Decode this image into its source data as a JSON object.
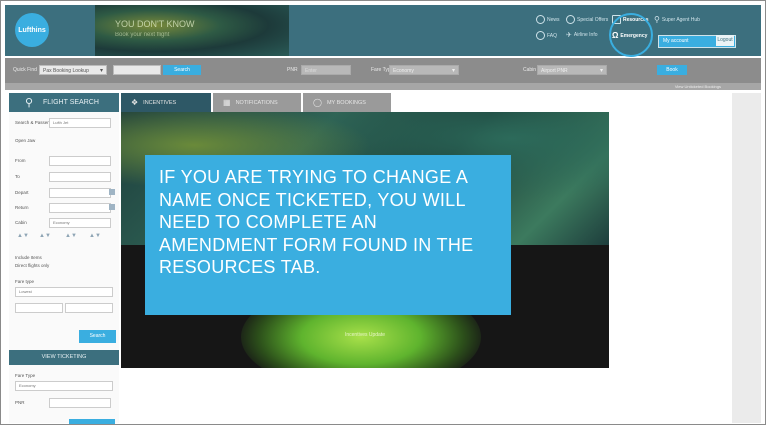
{
  "header": {
    "logo_text": "Lufthins",
    "banner_title": "YOU DON'T KNOW",
    "banner_subtitle": "Book your next flight",
    "links": [
      {
        "label": "News"
      },
      {
        "label": "Special Offers"
      },
      {
        "label": "Resources",
        "bold": true
      },
      {
        "label": "Super Agent Hub"
      },
      {
        "label": "FAQ"
      },
      {
        "label": "Airline Info"
      },
      {
        "label": "Emergency",
        "bold": true
      }
    ],
    "login_placeholder": "My account",
    "go_label": "Logout"
  },
  "toolbar": {
    "quick_label": "Quick Find",
    "quick_select": "Pax Booking Lookup",
    "search_value": "",
    "find_button": "Search",
    "pnr_label": "PNR",
    "pnr_value": "Enter",
    "fare_label": "Fare Type",
    "fare_select": "Economy",
    "cabin_label": "Cabin",
    "cabin_select": "Airport PNR",
    "go_button": "Book"
  },
  "strip_text": "View Unticketed Bookings",
  "sidebar": {
    "search_icon": "magnifier-icon",
    "search_label": "FLIGHT SEARCH",
    "rows": [
      {
        "label": "Search & Passenger",
        "value": "Lufth Jet"
      },
      {
        "label": "Open Jaw"
      },
      {
        "label": "From"
      },
      {
        "label": "To"
      },
      {
        "label": "Depart"
      },
      {
        "label": "Return"
      },
      {
        "label": "Cabin",
        "value": "Economy"
      },
      {
        "label": "Include Items"
      },
      {
        "label": "Direct flights only"
      },
      {
        "label": "Fare type",
        "value": "Lowest"
      }
    ],
    "search_button": "Search",
    "ticketing_label": "VIEW TICKETING",
    "ticket_rows": [
      {
        "label": "Fare Type",
        "value": "Economy"
      },
      {
        "label": "PNR"
      }
    ]
  },
  "tabs": [
    {
      "label": "INCENTIVES",
      "icon": "info-icon",
      "active": true
    },
    {
      "label": "NOTIFICATIONS",
      "icon": "document-icon",
      "active": false
    },
    {
      "label": "MY BOOKINGS",
      "icon": "globe-icon",
      "active": false
    }
  ],
  "content": {
    "glow_caption": "Incentives Update",
    "message": "IF YOU ARE TRYING TO CHANGE A NAME ONCE TICKETED, YOU WILL NEED TO COMPLETE AN AMENDMENT FORM FOUND IN THE RESOURCES TAB."
  },
  "colors": {
    "header": "#3c6f7e",
    "accent": "#3aaee0",
    "toolbar": "#8c8c8c",
    "tab_active": "#2e5866",
    "tab_inactive": "#9a9a9a"
  }
}
